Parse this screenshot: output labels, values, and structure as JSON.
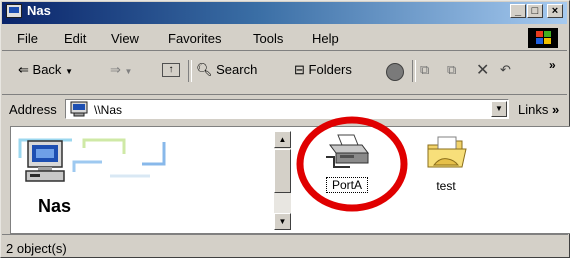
{
  "window": {
    "title": "Nas"
  },
  "menu": [
    "File",
    "Edit",
    "View",
    "Favorites",
    "Tools",
    "Help"
  ],
  "toolbar": {
    "back": "Back",
    "search": "Search",
    "folders": "Folders"
  },
  "address": {
    "label": "Address",
    "value": "\\\\Nas",
    "links": "Links",
    "more": "»"
  },
  "folder_panel": {
    "heading": "Nas"
  },
  "items": [
    {
      "name": "PortA",
      "icon": "printer-icon",
      "selected": true
    },
    {
      "name": "test",
      "icon": "folder-icon",
      "selected": false
    }
  ],
  "status": {
    "text": "2 object(s)"
  },
  "annotation": {
    "shape": "red-circle-highlight",
    "color": "#e00000"
  },
  "colors": {
    "titlebar": "#0a246a",
    "face": "#d4d0c8"
  }
}
